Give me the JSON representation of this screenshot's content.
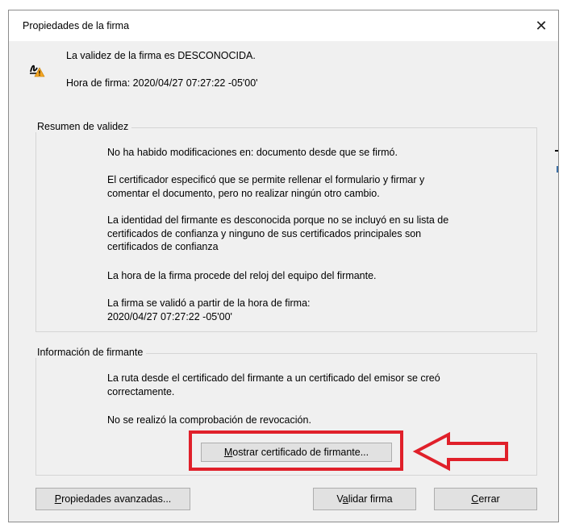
{
  "window": {
    "title": "Propiedades de la firma"
  },
  "status": {
    "validity": "La validez de la firma es DESCONOCIDA.",
    "sign_time": "Hora de firma:  2020/04/27 07:27:22 -05'00'"
  },
  "summary": {
    "label": "Resumen de validez",
    "p1": "No ha habido modificaciones en: documento desde que se firmó.",
    "p2a": "El certificador especificó que se permite rellenar el formulario y firmar y",
    "p2b": "comentar el documento, pero no realizar ningún otro cambio.",
    "p3a": "La identidad del firmante es desconocida porque no se incluyó en su lista de",
    "p3b": "certificados de confianza y ninguno de sus certificados principales son",
    "p3c": "certificados de confianza",
    "p4": "La hora de la firma procede del reloj del equipo del firmante.",
    "p5a": "La firma se validó a partir de la hora de firma:",
    "p5b": "2020/04/27 07:27:22 -05'00'"
  },
  "signer": {
    "label": "Información de firmante",
    "p1a": "La ruta desde el certificado del firmante a un certificado del emisor se creó",
    "p1b": "correctamente.",
    "p2": "No se realizó la comprobación de revocación.",
    "show_cert_hot": "M",
    "show_cert_rest": "ostrar certificado de firmante..."
  },
  "buttons": {
    "advanced_hot": "P",
    "advanced_rest": "ropiedades avanzadas...",
    "validate_pre": "V",
    "validate_hot": "a",
    "validate_rest": "lidar firma",
    "close_hot": "C",
    "close_rest": "errar"
  },
  "colors": {
    "highlight": "#e0202a",
    "warning": "#f5a623"
  }
}
